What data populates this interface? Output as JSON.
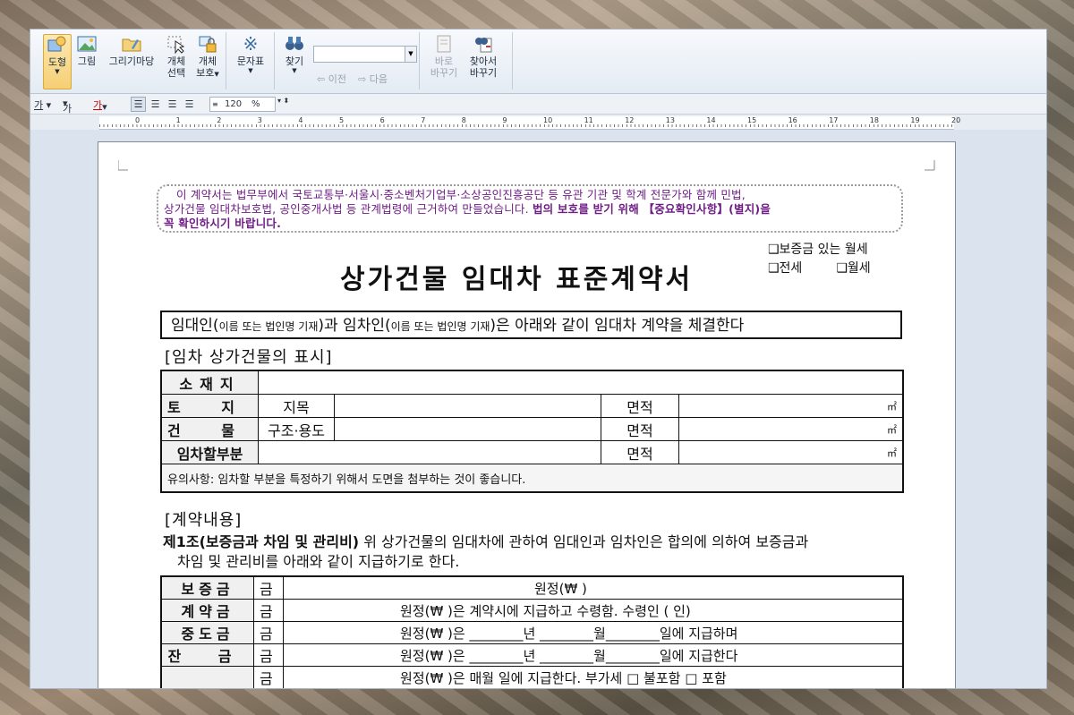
{
  "ribbon": {
    "shape_btn": "도형",
    "picture_btn": "그림",
    "drawing_btn": "그리기마당",
    "select_btn_1": "개체",
    "select_btn_2": "선택",
    "protect_btn_1": "개체",
    "protect_btn_2": "보호",
    "symbol_btn": "문자표",
    "find_btn": "찾기",
    "prev_btn": "이전",
    "next_btn": "다음",
    "replace_btn_1": "바로",
    "replace_btn_2": "바꾸기",
    "findreplace_btn_1": "찾아서",
    "findreplace_btn_2": "바꾸기"
  },
  "format_bar": {
    "font_btn_1": "가",
    "font_btn_2": "가",
    "font_color_btn": "가",
    "line_spacing": "120",
    "line_spacing_unit": "%"
  },
  "ruler": {
    "ticks": [
      "0",
      "1",
      "2",
      "3",
      "4",
      "5",
      "6",
      "7",
      "8",
      "9",
      "10",
      "11",
      "12",
      "13",
      "14",
      "15",
      "16",
      "17",
      "18",
      "19",
      "20"
    ]
  },
  "doc": {
    "notice_1": "이 계약서는 법무부에서 국토교통부·서울시·중소벤처기업부·소상공인진흥공단 등 유관 기관 및 학계 전문가와 함께 민법,",
    "notice_2": "상가건물 임대차보호법, 공인중개사법 등 관계법령에 근거하여 만들었습니다.",
    "notice_2b": "법의 보호를 받기 위해 【중요확인사항】(별지)을",
    "notice_3": "꼭 확인하시기 바랍니다.",
    "check_1": "❑보증금 있는 월세",
    "check_2": "❑전세",
    "check_3": "❑월세",
    "title": "상가건물 임대차 표준계약서",
    "parties_a": "임대인(",
    "parties_a_small": "이름 또는 법인명 기재",
    "parties_b": ")과 임차인(",
    "parties_b_small": "이름 또는 법인명 기재",
    "parties_c": ")은 아래와 같이 임대차 계약을 체결한다",
    "section_1": "[임차 상가건물의 표시]",
    "t1": {
      "location": "소재지",
      "land": "토 지",
      "land_sub": "지목",
      "building": "건 물",
      "building_sub": "구조·용도",
      "lease_part": "임차할부분",
      "area": "면적",
      "unit": "㎡",
      "note": "유의사항: 임차할 부분을 특정하기 위해서 도면을 첨부하는 것이 좋습니다."
    },
    "section_2": "[계약내용]",
    "article1_title": "제1조(보증금과 차임 및 관리비)",
    "article1_text": " 위 상가건물의 임대차에 관하여 임대인과 임차인은 합의에 의하여 보증금과",
    "article1_text2": "차임 및 관리비를 아래와 같이 지급하기로 한다.",
    "t2": {
      "deposit": "보증금",
      "contract": "계약금",
      "middle": "중도금",
      "balance": "잔 금",
      "gum": "금",
      "deposit_body": "원정(₩                                         )",
      "contract_body": "원정(₩                    )은 계약시에 지급하고 수령함. 수령인 (              인)",
      "middle_body": "원정(₩                    )은  ________년 ________월________일에 지급하며",
      "balance_body": "원정(₩                    )은  ________년 ________월________일에 지급한다",
      "rent_body": "원정(₩                    )은  매월      일에 지급한다. 부가세 □ 불포함  □ 포함"
    }
  }
}
